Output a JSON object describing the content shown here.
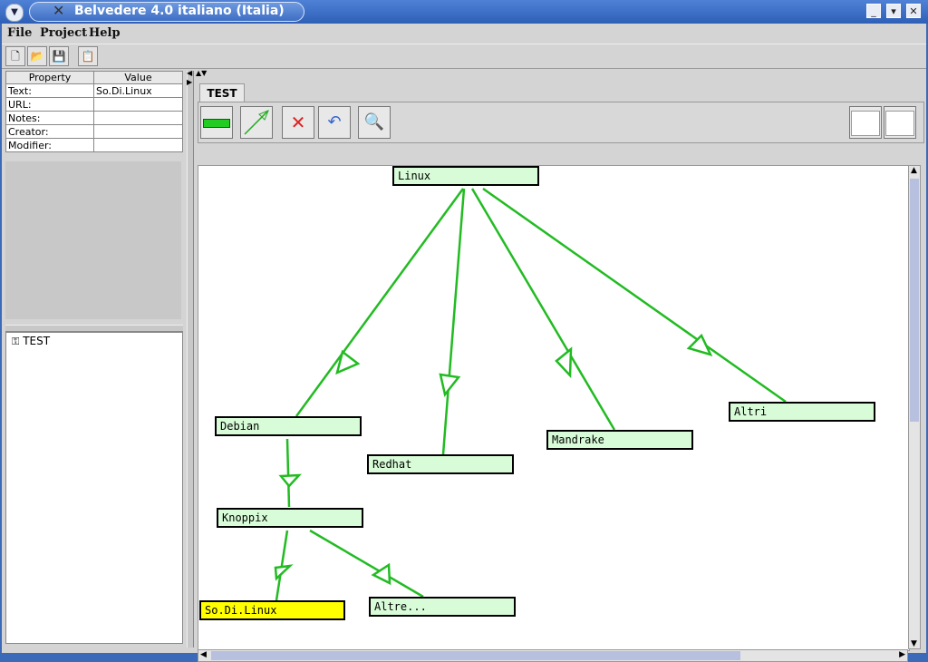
{
  "window": {
    "title": "Belvedere 4.0 italiano (Italia)"
  },
  "menu": {
    "file": "File",
    "project": "Project",
    "help": "Help"
  },
  "props": {
    "header_property": "Property",
    "header_value": "Value",
    "rows": [
      {
        "name": "Text:",
        "value": "So.Di.Linux"
      },
      {
        "name": "URL:",
        "value": ""
      },
      {
        "name": "Notes:",
        "value": ""
      },
      {
        "name": "Creator:",
        "value": ""
      },
      {
        "name": "Modifier:",
        "value": ""
      }
    ]
  },
  "tree": {
    "root": "TEST"
  },
  "tab": {
    "label": "TEST"
  },
  "nodes": {
    "linux": "Linux",
    "debian": "Debian",
    "redhat": "Redhat",
    "mandrake": "Mandrake",
    "altri": "Altri",
    "knoppix": "Knoppix",
    "sodilinux": "So.Di.Linux",
    "altre": "Altre..."
  },
  "colors": {
    "node_fill": "#d8fcd8",
    "selected_fill": "#ffff00",
    "link": "#22bb22"
  }
}
